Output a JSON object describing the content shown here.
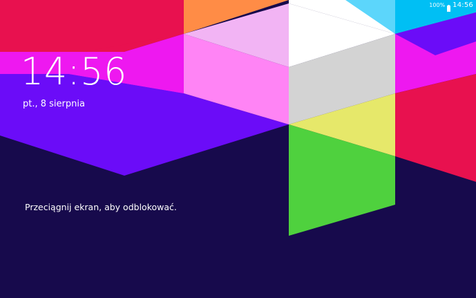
{
  "status_bar": {
    "battery_percent": "100%",
    "time": "14:56",
    "battery_icon": "battery-full-icon"
  },
  "lockscreen": {
    "clock": "14:56",
    "date": "pt., 8 sierpnia",
    "unlock_hint": "Przeciągnij ekran, aby odblokować."
  },
  "colors": {
    "background": "#170a4c",
    "text": "#ffffff"
  }
}
